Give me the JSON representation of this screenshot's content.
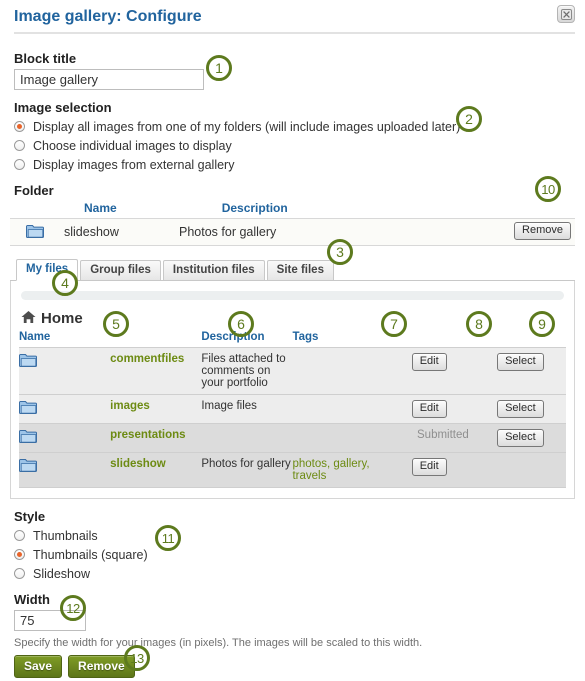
{
  "header": {
    "title": "Image gallery: Configure",
    "close_icon": "close-icon"
  },
  "block_title": {
    "label": "Block title",
    "value": "Image gallery"
  },
  "image_selection": {
    "label": "Image selection",
    "options": [
      {
        "label": "Display all images from one of my folders (will include images uploaded later)",
        "selected": true
      },
      {
        "label": "Choose individual images to display",
        "selected": false
      },
      {
        "label": "Display images from external gallery",
        "selected": false
      }
    ]
  },
  "folder": {
    "label": "Folder",
    "columns": {
      "name": "Name",
      "description": "Description"
    },
    "row": {
      "name": "slideshow",
      "description": "Photos for gallery"
    },
    "remove_label": "Remove"
  },
  "file_browser": {
    "tabs": [
      {
        "label": "My files",
        "active": true
      },
      {
        "label": "Group files",
        "active": false
      },
      {
        "label": "Institution files",
        "active": false
      },
      {
        "label": "Site files",
        "active": false
      }
    ],
    "breadcrumb": "Home",
    "home_icon": "home-icon",
    "columns": {
      "name": "Name",
      "description": "Description",
      "tags": "Tags"
    },
    "rows": [
      {
        "icon": "folder-icon",
        "name": "commentfiles",
        "description": "Files attached to comments on your portfolio",
        "tags": "",
        "status": "",
        "edit_label": "Edit",
        "select_label": "Select"
      },
      {
        "icon": "folder-icon",
        "name": "images",
        "description": "Image files",
        "tags": "",
        "status": "",
        "edit_label": "Edit",
        "select_label": "Select"
      },
      {
        "icon": "folder-icon",
        "name": "presentations",
        "description": "",
        "tags": "",
        "status": "Submitted",
        "edit_label": "",
        "select_label": "Select"
      },
      {
        "icon": "folder-icon",
        "name": "slideshow",
        "description": "Photos for gallery",
        "tags": "photos, gallery, travels",
        "status": "",
        "edit_label": "Edit",
        "select_label": ""
      }
    ]
  },
  "style": {
    "label": "Style",
    "options": [
      {
        "label": "Thumbnails",
        "selected": false
      },
      {
        "label": "Thumbnails (square)",
        "selected": true
      },
      {
        "label": "Slideshow",
        "selected": false
      }
    ]
  },
  "width": {
    "label": "Width",
    "value": "75",
    "help": "Specify the width for your images (in pixels). The images will be scaled to this width."
  },
  "footer": {
    "save_label": "Save",
    "remove_label": "Remove"
  },
  "annotations": {
    "a1": "1",
    "a2": "2",
    "a3": "3",
    "a4": "4",
    "a5": "5",
    "a6": "6",
    "a7": "7",
    "a8": "8",
    "a9": "9",
    "a10": "10",
    "a11": "11",
    "a12": "12",
    "a13": "13"
  },
  "colors": {
    "title_blue": "#21649e",
    "link_green": "#6d8b13",
    "annotation_green": "#5d7a1e",
    "radio_dot_orange": "#e8642a",
    "button_green": "#5d7519"
  }
}
